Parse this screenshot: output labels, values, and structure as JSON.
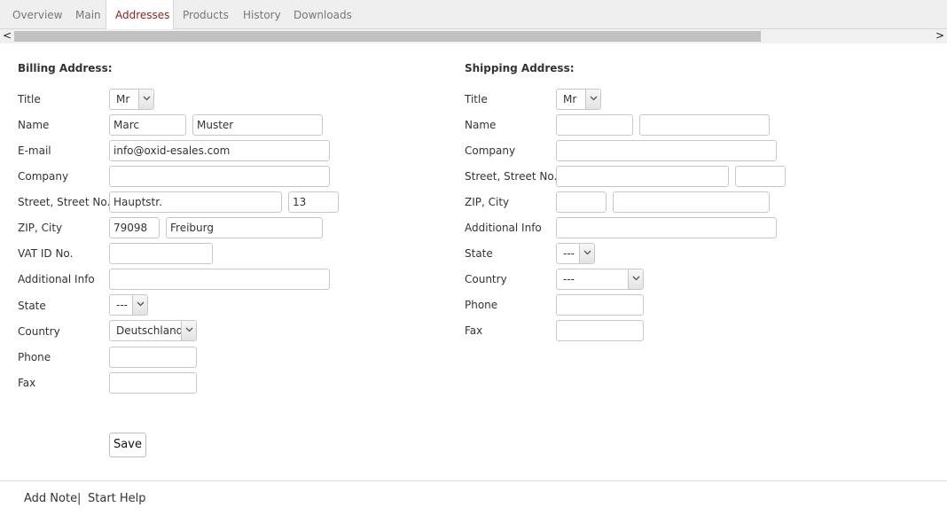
{
  "tabs": [
    {
      "label": "Overview",
      "active": false
    },
    {
      "label": "Main",
      "active": false
    },
    {
      "label": "Addresses",
      "active": true
    },
    {
      "label": "Products",
      "active": false
    },
    {
      "label": "History",
      "active": false
    },
    {
      "label": "Downloads",
      "active": false
    }
  ],
  "scrollbar": {
    "left_arrow": "<",
    "right_arrow": ">"
  },
  "billing": {
    "heading": "Billing Address:",
    "labels": {
      "title": "Title",
      "name": "Name",
      "email": "E-mail",
      "company": "Company",
      "street": "Street, Street No.",
      "zip_city": "ZIP, City",
      "vat": "VAT ID No.",
      "additional": "Additional Info",
      "state": "State",
      "country": "Country",
      "phone": "Phone",
      "fax": "Fax"
    },
    "values": {
      "title": "Mr",
      "first_name": "Marc",
      "last_name": "Muster",
      "email": "info@oxid-esales.com",
      "company": "",
      "street": "Hauptstr.",
      "street_no": "13",
      "zip": "79098",
      "city": "Freiburg",
      "vat": "",
      "additional": "",
      "state": "---",
      "country": "Deutschland",
      "phone": "",
      "fax": ""
    }
  },
  "shipping": {
    "heading": "Shipping Address:",
    "labels": {
      "title": "Title",
      "name": "Name",
      "company": "Company",
      "street": "Street, Street No.",
      "zip_city": "ZIP, City",
      "additional": "Additional Info",
      "state": "State",
      "country": "Country",
      "phone": "Phone",
      "fax": "Fax"
    },
    "values": {
      "title": "Mr",
      "first_name": "",
      "last_name": "",
      "company": "",
      "street": "",
      "street_no": "",
      "zip": "",
      "city": "",
      "additional": "",
      "state": "---",
      "country": "---",
      "phone": "",
      "fax": ""
    }
  },
  "actions": {
    "save": "Save"
  },
  "footer": {
    "add_note": "Add Note",
    "separator": "|",
    "start_help": "Start Help"
  },
  "colors": {
    "active_tab": "#8a1f1f",
    "tab_text": "#777777",
    "tabbar_bg": "#efefef"
  }
}
